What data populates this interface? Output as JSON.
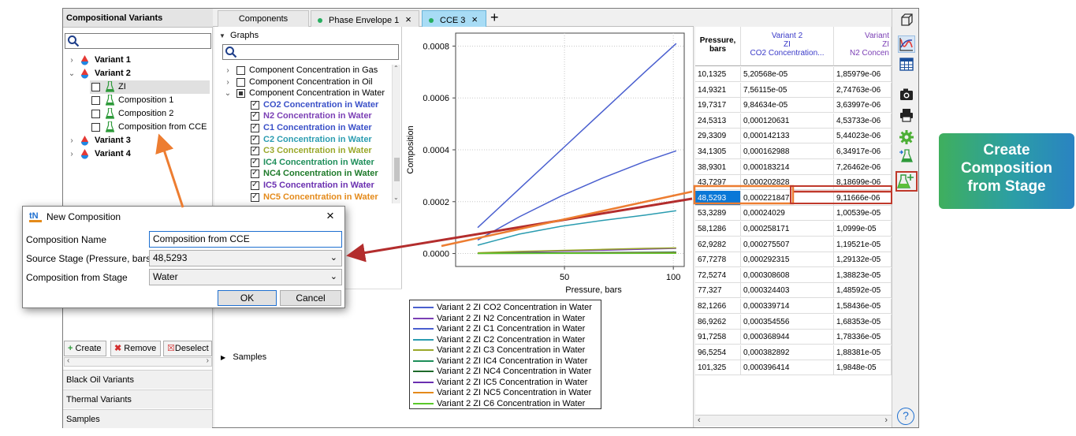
{
  "colors": {
    "accent": "#1d7fd0",
    "callout_green": "#3faf5d",
    "callout_blue": "#2a83c2",
    "arrow_orange": "#ed7d31",
    "arrow_red": "#b32d2d",
    "selected": "#0a78d7"
  },
  "left_panel": {
    "title": "Compositional Variants",
    "tree": [
      {
        "label": "Variant 1",
        "level": 0,
        "bold": true
      },
      {
        "label": "Variant 2",
        "level": 0,
        "bold": true
      },
      {
        "label": "ZI",
        "level": 1
      },
      {
        "label": "Composition 1",
        "level": 1
      },
      {
        "label": "Composition 2",
        "level": 1
      },
      {
        "label": "Composition from CCE",
        "level": 1
      },
      {
        "label": "Variant 3",
        "level": 0,
        "bold": true
      },
      {
        "label": "Variant 4",
        "level": 0,
        "bold": true
      }
    ],
    "buttons": {
      "create": "Create",
      "remove": "Remove",
      "deselect": "Deselect"
    },
    "sections": [
      "Black Oil Variants",
      "Thermal Variants",
      "Samples"
    ]
  },
  "tabs": [
    {
      "label": "Components"
    },
    {
      "label": "Phase Envelope 1",
      "close": "×"
    },
    {
      "label": "CCE 3",
      "close": "×"
    }
  ],
  "add_tab": "+",
  "graphs_panel": {
    "header": "Graphs",
    "items": [
      {
        "label": "Component Concentration in Gas",
        "color": "#000000"
      },
      {
        "label": "Component Concentration in Oil",
        "color": "#000000"
      },
      {
        "label": "Component Concentration in Water",
        "color": "#000000"
      },
      {
        "label": "CO2 Concentration in Water",
        "color": "#3a50c8"
      },
      {
        "label": "N2 Concentration in Water",
        "color": "#7b3fb5"
      },
      {
        "label": "C1 Concentration in Water",
        "color": "#3a50c8"
      },
      {
        "label": "C2 Concentration in Water",
        "color": "#2a9cb0"
      },
      {
        "label": "C3 Concentration in Water",
        "color": "#9aa82a"
      },
      {
        "label": "IC4 Concentration in Water",
        "color": "#1e8e5a"
      },
      {
        "label": "NC4 Concentration in Water",
        "color": "#1e7a2a"
      },
      {
        "label": "IC5 Concentration in Water",
        "color": "#6a2fb0"
      },
      {
        "label": "NC5 Concentration in Water",
        "color": "#e48a1a"
      }
    ],
    "samples_label": "Samples"
  },
  "chart_data": {
    "type": "line",
    "xlabel": "Pressure, bars",
    "ylabel": "Composition",
    "xlim": [
      0,
      105
    ],
    "ylim": [
      -5e-05,
      0.00085
    ],
    "xticks": [
      50,
      100
    ],
    "yticks": [
      0.0,
      0.0002,
      0.0004,
      0.0006,
      0.0008
    ],
    "ytick_labels": [
      "0.0000",
      "0.0002",
      "0.0004",
      "0.0006",
      "0.0008"
    ],
    "grid": true,
    "legend_position": "bottom",
    "series": [
      {
        "name": "Variant 2 ZI CO2 Concentration in Water",
        "color": "#4a5fcf",
        "x": [
          10.1325,
          29.3309,
          48.5293,
          67.7278,
          86.9262,
          101.325
        ],
        "y": [
          5.21e-05,
          0.000142,
          0.000222,
          0.000292,
          0.000355,
          0.000396
        ]
      },
      {
        "name": "Variant 2 ZI N2 Concentration in Water",
        "color": "#7b3fb5",
        "x": [
          10.1325,
          29.3309,
          48.5293,
          67.7278,
          86.9262,
          101.325
        ],
        "y": [
          1.9e-06,
          5.4e-06,
          9.1e-06,
          1.29e-05,
          1.68e-05,
          1.98e-05
        ]
      },
      {
        "name": "Variant 2 ZI C1 Concentration in Water",
        "color": "#4a5fcf",
        "x": [
          10.1325,
          29.3309,
          48.5293,
          67.7278,
          86.9262,
          101.325
        ],
        "y": [
          0.0001,
          0.00025,
          0.0004,
          0.00055,
          0.0007,
          0.00081
        ]
      },
      {
        "name": "Variant 2 ZI C2 Concentration in Water",
        "color": "#2a9cb0",
        "x": [
          10.1325,
          29.3309,
          48.5293,
          67.7278,
          86.9262,
          101.325
        ],
        "y": [
          3.2e-05,
          7.5e-05,
          0.000105,
          0.000128,
          0.000148,
          0.000165
        ]
      },
      {
        "name": "Variant 2 ZI C3 Concentration in Water",
        "color": "#9aa82a",
        "x": [
          10.1325,
          29.3309,
          48.5293,
          67.7278,
          86.9262,
          101.325
        ],
        "y": [
          3e-06,
          8e-06,
          1.2e-05,
          1.6e-05,
          2e-05,
          2.2e-05
        ]
      },
      {
        "name": "Variant 2 ZI IC4 Concentration in Water",
        "color": "#1e8e5a",
        "x": [
          10.1325,
          101.325
        ],
        "y": [
          1e-06,
          4e-06
        ]
      },
      {
        "name": "Variant 2 ZI NC4 Concentration in Water",
        "color": "#1e6a2a",
        "x": [
          10.1325,
          101.325
        ],
        "y": [
          1e-06,
          5e-06
        ]
      },
      {
        "name": "Variant 2 ZI IC5 Concentration in Water",
        "color": "#6a2fb0",
        "x": [
          10.1325,
          101.325
        ],
        "y": [
          5e-07,
          2e-06
        ]
      },
      {
        "name": "Variant 2 ZI NC5 Concentration in Water",
        "color": "#e48a1a",
        "x": [
          10.1325,
          101.325
        ],
        "y": [
          5e-07,
          2e-06
        ]
      },
      {
        "name": "Variant 2 ZI C6 Concentration in Water",
        "color": "#5ac82a",
        "x": [
          10.1325,
          101.325
        ],
        "y": [
          3e-07,
          1e-06
        ]
      }
    ]
  },
  "table": {
    "headers": [
      {
        "line1": "Pressure,",
        "line2": "bars",
        "line3": ""
      },
      {
        "line1": "Variant 2",
        "line2": "ZI",
        "line3": "CO2 Concentration..."
      },
      {
        "line1": "Variant",
        "line2": "ZI",
        "line3": "N2 Concen"
      }
    ],
    "rows": [
      [
        "10,1325",
        "5,20568e-05",
        "1,85979e-06"
      ],
      [
        "14,9321",
        "7,56115e-05",
        "2,74763e-06"
      ],
      [
        "19,7317",
        "9,84634e-05",
        "3,63997e-06"
      ],
      [
        "24,5313",
        "0,000120631",
        "4,53733e-06"
      ],
      [
        "29,3309",
        "0,000142133",
        "5,44023e-06"
      ],
      [
        "34,1305",
        "0,000162988",
        "6,34917e-06"
      ],
      [
        "38,9301",
        "0,000183214",
        "7,26462e-06"
      ],
      [
        "43,7297",
        "0,000202828",
        "8,18699e-06"
      ],
      [
        "48,5293",
        "0,000221847",
        "9,11666e-06"
      ],
      [
        "53,3289",
        "0,00024029",
        "1,00539e-05"
      ],
      [
        "58,1286",
        "0,000258171",
        "1,0999e-05"
      ],
      [
        "62,9282",
        "0,000275507",
        "1,19521e-05"
      ],
      [
        "67,7278",
        "0,000292315",
        "1,29132e-05"
      ],
      [
        "72,5274",
        "0,000308608",
        "1,38823e-05"
      ],
      [
        "77,327",
        "0,000324403",
        "1,48592e-05"
      ],
      [
        "82,1266",
        "0,000339714",
        "1,58436e-05"
      ],
      [
        "86,9262",
        "0,000354556",
        "1,68353e-05"
      ],
      [
        "91,7258",
        "0,000368944",
        "1,78336e-05"
      ],
      [
        "96,5254",
        "0,000382892",
        "1,88381e-05"
      ],
      [
        "101,325",
        "0,000396414",
        "1,9848e-05"
      ]
    ],
    "selected_row": 8
  },
  "dialog": {
    "title": "New Composition",
    "logo": "tN",
    "close": "×",
    "fields": [
      {
        "label": "Composition Name",
        "value": "Composition from CCE"
      },
      {
        "label": "Source Stage (Pressure, bars)",
        "value": "48,5293"
      },
      {
        "label": "Composition from Stage",
        "value": "Water"
      }
    ],
    "ok": "OK",
    "cancel": "Cancel"
  },
  "toolbar": [
    "cube-icon",
    "chart-icon",
    "table-icon",
    "camera-icon",
    "print-icon",
    "gear-icon",
    "flask-swap-icon",
    "flask-plus-icon",
    "help-icon"
  ],
  "help_label": "?",
  "callout": {
    "line1": "Create",
    "line2": "Composition",
    "line3": "from Stage"
  }
}
